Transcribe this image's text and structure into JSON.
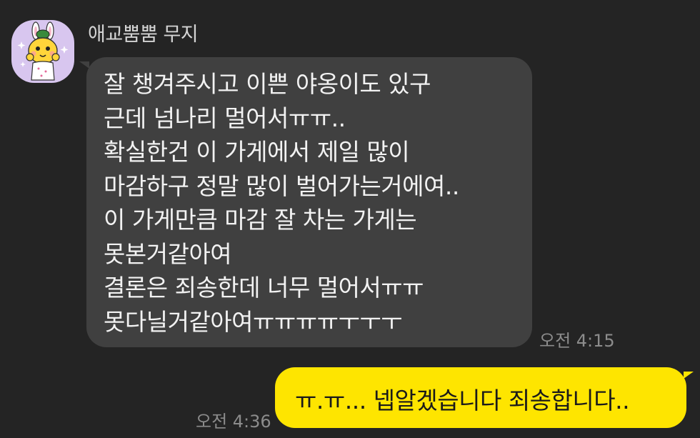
{
  "chat": {
    "sender_name": "애교뿜뿜 무지",
    "avatar_icon": "muzi-character-icon",
    "incoming_message": {
      "lines": [
        "잘 챙겨주시고 이쁜 야옹이도 있구",
        "근데 넘나리 멀어서ㅠㅠ..",
        "확실한건 이 가게에서 제일 많이",
        "마감하구 정말 많이 벌어가는거에여..",
        "이 가게만큼 마감 잘 차는 가게는",
        "못본거같아여",
        "결론은 죄송한데 너무 멀어서ㅠㅠ",
        "못다닐거같아여ㅠㅠㅠㅠㅜㅜㅜ"
      ],
      "time": "오전 4:15"
    },
    "outgoing_message": {
      "text": "ㅠ.ㅠ... 넵알겠습니다 죄송합니다..",
      "time": "오전 4:36"
    }
  },
  "colors": {
    "background": "#242424",
    "incoming_bubble": "#404040",
    "outgoing_bubble": "#fee500",
    "avatar_background": "#d8c6ef"
  }
}
